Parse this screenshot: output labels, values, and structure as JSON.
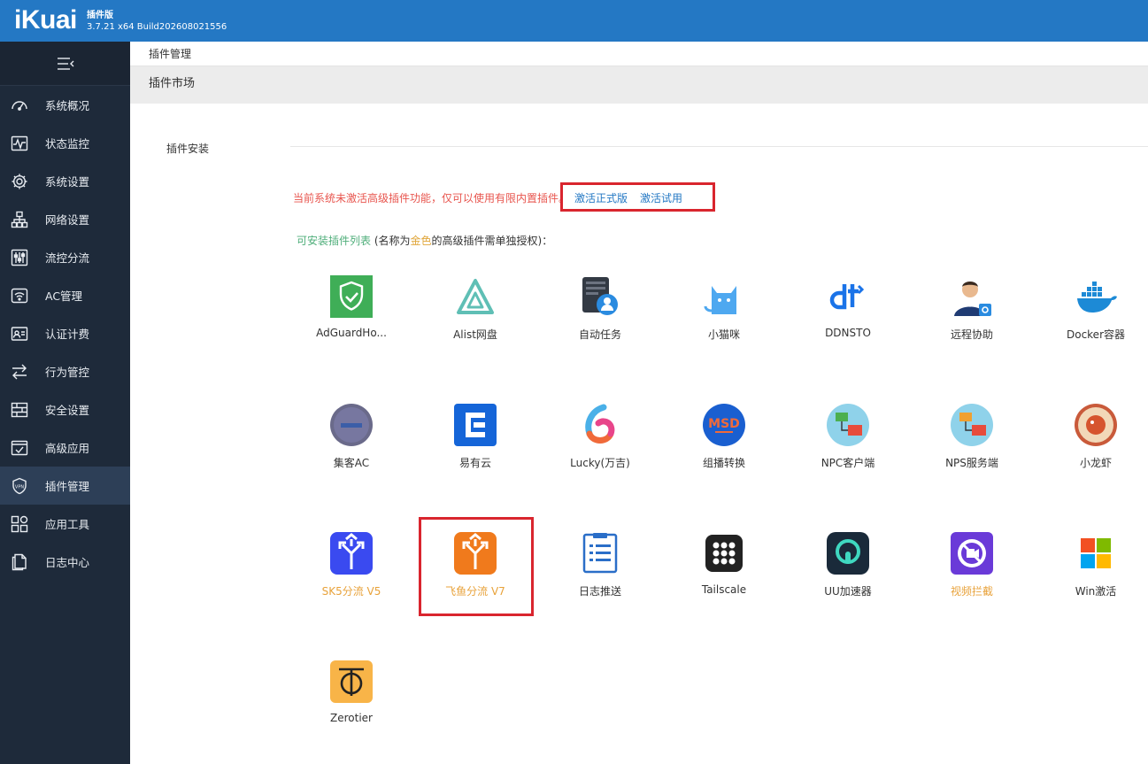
{
  "header": {
    "logo": "iKuai",
    "edition": "插件版",
    "build": "3.7.21 x64 Build202608021556"
  },
  "sidebar": {
    "toggle_icon": "menu-collapse-icon",
    "items": [
      {
        "label": "系统概况",
        "icon": "dashboard-icon"
      },
      {
        "label": "状态监控",
        "icon": "pulse-icon"
      },
      {
        "label": "系统设置",
        "icon": "gear-icon"
      },
      {
        "label": "网络设置",
        "icon": "network-icon"
      },
      {
        "label": "流控分流",
        "icon": "sliders-icon"
      },
      {
        "label": "AC管理",
        "icon": "wifi-icon"
      },
      {
        "label": "认证计费",
        "icon": "id-card-icon"
      },
      {
        "label": "行为管控",
        "icon": "arrows-icon"
      },
      {
        "label": "安全设置",
        "icon": "firewall-icon"
      },
      {
        "label": "高级应用",
        "icon": "check-box-icon"
      },
      {
        "label": "插件管理",
        "icon": "plugin-shield-icon",
        "active": true
      },
      {
        "label": "应用工具",
        "icon": "apps-icon"
      },
      {
        "label": "日志中心",
        "icon": "document-icon"
      }
    ]
  },
  "main": {
    "breadcrumb": "插件管理",
    "panel_title": "插件市场",
    "side_tab": "插件安装",
    "notice": {
      "text": "当前系统未激活高级插件功能，仅可以使用有限内置插件。",
      "activate_full": "激活正式版",
      "activate_trial": "激活试用"
    },
    "list_label": {
      "prefix": "可安装插件列表",
      "mid1": " (名称为",
      "gold": "金色",
      "mid2": "的高级插件需单独授权)："
    },
    "plugins": [
      {
        "name": "AdGuardHo...",
        "icon": "adguard-icon"
      },
      {
        "name": "Alist网盘",
        "icon": "alist-icon"
      },
      {
        "name": "自动任务",
        "icon": "auto-task-icon"
      },
      {
        "name": "小猫咪",
        "icon": "cat-icon"
      },
      {
        "name": "DDNSTO",
        "icon": "ddnsto-icon"
      },
      {
        "name": "远程协助",
        "icon": "remote-assist-icon"
      },
      {
        "name": "Docker容器",
        "icon": "docker-icon"
      },
      {
        "name": "集客AC",
        "icon": "gecoos-icon"
      },
      {
        "name": "易有云",
        "icon": "yiyouyun-icon"
      },
      {
        "name": "Lucky(万吉)",
        "icon": "lucky-icon"
      },
      {
        "name": "组播转换",
        "icon": "msd-icon"
      },
      {
        "name": "NPC客户端",
        "icon": "npc-icon"
      },
      {
        "name": "NPS服务端",
        "icon": "nps-icon"
      },
      {
        "name": "小龙虾",
        "icon": "lobster-icon"
      },
      {
        "name": "SK5分流 V5",
        "icon": "sk5-icon",
        "gold": true
      },
      {
        "name": "飞鱼分流 V7",
        "icon": "feiyu-icon",
        "gold": true
      },
      {
        "name": "日志推送",
        "icon": "log-push-icon"
      },
      {
        "name": "Tailscale",
        "icon": "tailscale-icon"
      },
      {
        "name": "UU加速器",
        "icon": "uu-icon"
      },
      {
        "name": "视频拦截",
        "icon": "video-block-icon",
        "gold": true
      },
      {
        "name": "Win激活",
        "icon": "windows-icon"
      },
      {
        "name": "Zerotier",
        "icon": "zerotier-icon"
      }
    ]
  },
  "colors": {
    "header": "#2478c4",
    "sidebar": "#1e2a3a",
    "gold": "#e8a23a",
    "highlight": "#d9252e"
  }
}
